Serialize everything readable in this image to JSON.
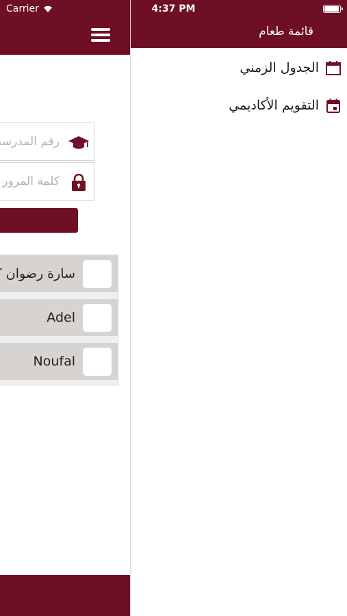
{
  "status_bar": {
    "carrier": "Carrier",
    "time": "4:37 PM"
  },
  "main": {
    "login_form": {
      "student_number_placeholder": "رقم المدرسة",
      "password_placeholder": "كلمة المرور"
    },
    "students": [
      {
        "name": "سارة رضوان كـ"
      },
      {
        "name": "Adel"
      },
      {
        "name": "Noufal"
      }
    ]
  },
  "drawer": {
    "title": "قائمة طعام",
    "items": [
      {
        "label": "الجدول الزمني",
        "icon": "calendar-outline-icon"
      },
      {
        "label": "التقويم الأكاديمي",
        "icon": "calendar-event-icon"
      }
    ]
  },
  "colors": {
    "brand": "#6e0f25",
    "row_bg": "#d6d3d0",
    "list_bg": "#efefef"
  }
}
